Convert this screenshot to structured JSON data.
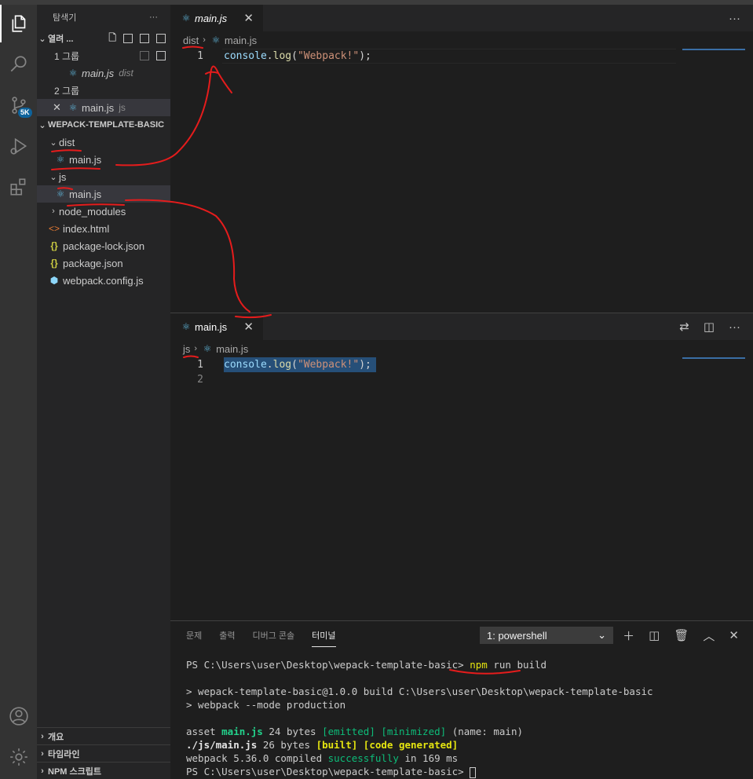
{
  "sidebar": {
    "title": "탐색기",
    "open_editors": {
      "label": "열려 ...",
      "groups": [
        {
          "label": "1 그룹",
          "files": [
            {
              "name": "main.js",
              "desc": "dist"
            }
          ]
        },
        {
          "label": "2 그룹",
          "files": [
            {
              "name": "main.js",
              "desc": "js"
            }
          ]
        }
      ]
    },
    "project": {
      "label": "WEPACK-TEMPLATE-BASIC",
      "tree": [
        {
          "name": "dist"
        },
        {
          "name": "main.js"
        },
        {
          "name": "js"
        },
        {
          "name": "main.js"
        },
        {
          "name": "node_modules"
        },
        {
          "name": "index.html",
          "icon": "<>"
        },
        {
          "name": "package-lock.json",
          "icon": "{}"
        },
        {
          "name": "package.json",
          "icon": "{}"
        },
        {
          "name": "webpack.config.js"
        }
      ]
    },
    "bottom_sections": [
      "개요",
      "타임라인",
      "NPM 스크립트"
    ]
  },
  "activity": {
    "badge": "5K"
  },
  "editor_top": {
    "tab": "main.js",
    "breadcrumb": [
      "dist",
      "main.js"
    ],
    "lines": [
      {
        "num": "1",
        "fn": "console",
        "dot": ".",
        "method": "log",
        "open": "(",
        "str": "\"Webpack!\"",
        "close": ");"
      }
    ]
  },
  "editor_bottom": {
    "tab": "main.js",
    "breadcrumb": [
      "js",
      "main.js"
    ],
    "line_numbers": [
      "1",
      "2"
    ],
    "code": {
      "fn": "console",
      "dot": ".",
      "method": "log",
      "open": "(",
      "str": "\"Webpack!\"",
      "close": ");"
    }
  },
  "panel": {
    "tabs": [
      "문제",
      "출력",
      "디버그 콘솔",
      "터미널"
    ],
    "terminal_select": "1: powershell",
    "prompt": "PS C:\\Users\\user\\Desktop\\wepack-template-basic> ",
    "cmd_npm": "npm",
    "cmd_rest": " run build",
    "line_build": "> wepack-template-basic@1.0.0 build C:\\Users\\user\\Desktop\\wepack-template-basic",
    "line_webpack": "> webpack --mode production",
    "asset": {
      "pre": "asset ",
      "file": "main.js",
      "size": " 24 bytes ",
      "emitted": "[emitted]",
      "sp": " ",
      "minimized": "[minimized]",
      "post": " (name: main)"
    },
    "module": {
      "file": "./js/main.js",
      "size": " 26 bytes ",
      "built": "[built]",
      "sp": " ",
      "generated": "[code generated]"
    },
    "compiled": {
      "pre": "webpack 5.36.0 compiled ",
      "status": "successfully",
      "post": " in 169 ms"
    }
  }
}
